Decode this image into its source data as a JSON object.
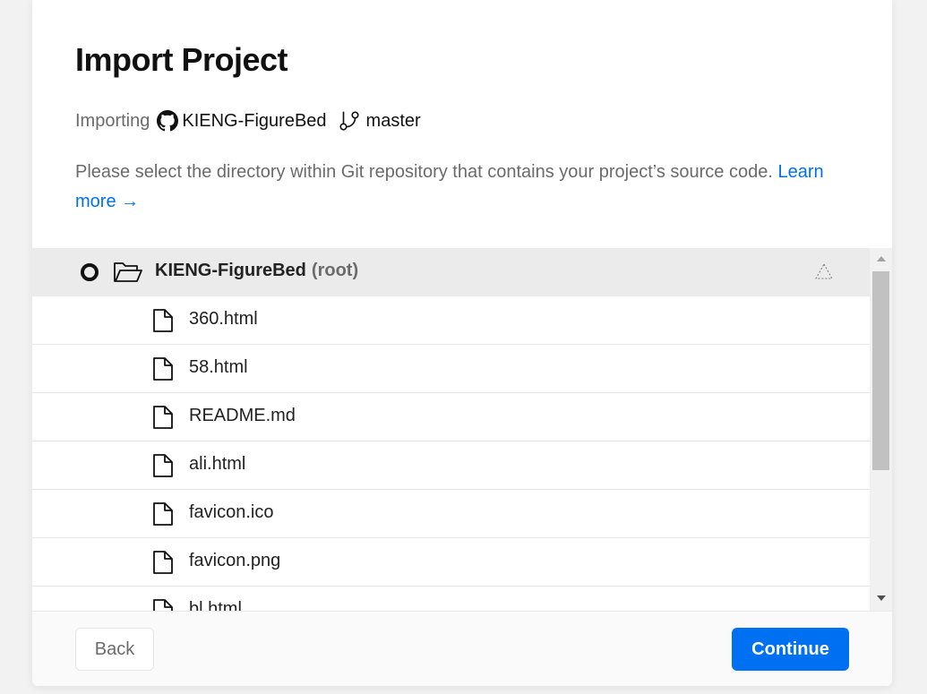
{
  "modal": {
    "title": "Import Project",
    "importing": {
      "label": "Importing",
      "repo_icon": "github-icon",
      "repo": "KIENG-FigureBed",
      "branch_icon": "git-branch-icon",
      "branch": "master"
    },
    "description": "Please select the directory within Git repository that contains your project’s source code.",
    "learn_more": "Learn more →"
  },
  "tree": {
    "root": {
      "name": "KIENG-FigureBed",
      "suffix": "(root)",
      "icon": "folder-open-icon",
      "framework_icon": "vercel-triangle-icon",
      "selected": false
    },
    "files": [
      {
        "name": "360.html",
        "icon": "file-icon"
      },
      {
        "name": "58.html",
        "icon": "file-icon"
      },
      {
        "name": "README.md",
        "icon": "file-icon"
      },
      {
        "name": "ali.html",
        "icon": "file-icon"
      },
      {
        "name": "favicon.ico",
        "icon": "file-icon"
      },
      {
        "name": "favicon.png",
        "icon": "file-icon"
      },
      {
        "name": "bl.html",
        "icon": "file-icon"
      }
    ]
  },
  "footer": {
    "back_label": "Back",
    "continue_label": "Continue"
  },
  "colors": {
    "accent": "#0070f3",
    "root_row_bg": "#ebebeb",
    "muted_text": "#6b6b6b"
  }
}
